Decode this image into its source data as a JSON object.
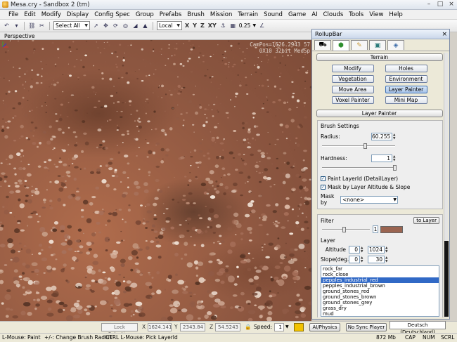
{
  "window": {
    "title": "Mesa.cry - Sandbox 2 (tm)",
    "controls": [
      "–",
      "□",
      "×"
    ]
  },
  "menu": [
    "File",
    "Edit",
    "Modify",
    "Display",
    "Config Spec",
    "Group",
    "Prefabs",
    "Brush",
    "Mission",
    "Terrain",
    "Sound",
    "Game",
    "AI",
    "Clouds",
    "Tools",
    "View",
    "Help"
  ],
  "toolbar": {
    "selection": "Select All",
    "coord_system": "Local",
    "axes": [
      "X",
      "Y",
      "Z",
      "XY"
    ],
    "grid_size": "0.25"
  },
  "viewport": {
    "title": "Perspective",
    "campos_line1": "CamPos=1626.2943   57",
    "campos_line2": "0X10 32bit MedSp"
  },
  "rollup": {
    "title": "RollupBar",
    "tabs": [
      "objects-tab",
      "terrain-tab",
      "modeling-tab",
      "display-tab",
      "layers-tab"
    ],
    "terrain_header": "Terrain",
    "terrain_buttons": [
      "Modify",
      "Holes",
      "Vegetation",
      "Environment",
      "Move Area",
      "Layer Painter",
      "Voxel Painter",
      "Mini Map"
    ],
    "active_button": "Layer Painter",
    "layer_painter_header": "Layer Painter",
    "brush_settings_label": "Brush Settings",
    "radius_label": "Radius:",
    "radius_value": "60.255",
    "radius_fraction": 0.58,
    "hardness_label": "Hardness:",
    "hardness_value": "1",
    "hardness_fraction": 1.0,
    "paint_layerid_label": "Paint LayerId (DetailLayer)",
    "mask_altitude_label": "Mask by Layer Altitude & Slope",
    "mask_by_label": "Mask by",
    "mask_by_value": "<none>",
    "filter_label": "Filter",
    "to_layer_label": "to Layer",
    "filter_value": "1",
    "filter_fraction": 0.45,
    "layer_label": "Layer",
    "altitude_label": "Altitude",
    "altitude_min": "0",
    "altitude_max": "1024",
    "slope_label": "Slope(deg.)",
    "slope_min": "0",
    "slope_max": "30",
    "swatch_color": "#9a6450",
    "layers": [
      "rock_far",
      "rock_close",
      "pepples_industrial_red",
      "pepples_industrial_brown",
      "ground_stones_red",
      "ground_stones_brown",
      "ground_stones_grey",
      "grass_dry",
      "mud"
    ],
    "selected_layer": "pepples_industrial_red"
  },
  "controls": {
    "lock_selection": "Lock Selection",
    "x_label": "X",
    "x_value": "1624.141",
    "y_label": "Y",
    "y_value": "2343.84",
    "z_label": "Z",
    "z_value": "54.5243",
    "speed_label": "Speed:",
    "speed_value": "1",
    "ai_physics": "AI/Physics",
    "sync_player": "No Sync Player",
    "language": "Deutsch (Deutschland)"
  },
  "status": {
    "hint_left": "L-Mouse: Paint",
    "hint_mid": "+/-: Change Brush Radius",
    "hint_right": "CTRL L-Mouse: Pick LayerId",
    "memory": "872 Mb",
    "cap": "CAP",
    "num": "NUM",
    "scrl": "SCRL"
  }
}
